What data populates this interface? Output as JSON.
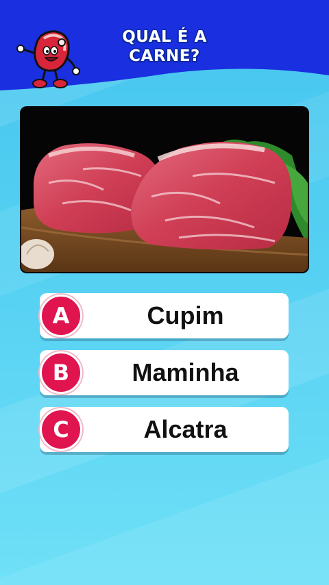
{
  "header": {
    "title_line1": "QUAL É A",
    "title_line2": "CARNE?",
    "mascot_icon": "meat-mascot-icon",
    "colors": {
      "header_blue": "#1a2fe0",
      "title_outline": "#0d2aa8"
    }
  },
  "photo": {
    "description_icon": "raw-beef-photo"
  },
  "answers": [
    {
      "letter": "A",
      "text": "Cupim"
    },
    {
      "letter": "B",
      "text": "Maminha"
    },
    {
      "letter": "C",
      "text": "Alcatra"
    }
  ],
  "colors": {
    "letter_badge": "#e0154f",
    "background": "#5cd6f3",
    "card": "#ffffff"
  }
}
